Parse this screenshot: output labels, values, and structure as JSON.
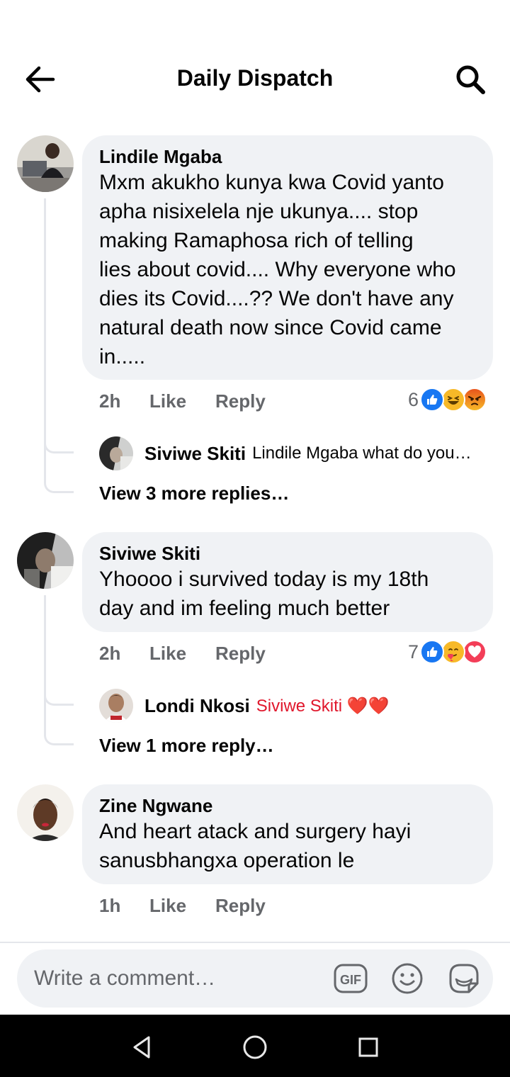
{
  "header": {
    "title": "Daily Dispatch",
    "back_icon": "arrow-left-icon",
    "search_icon": "search-icon"
  },
  "colors": {
    "bubble": "#f0f2f5",
    "meta_text": "#65676b",
    "like_blue": "#1877f2",
    "love_red": "#f33e58",
    "haha_yellow": "#f7b928"
  },
  "comments": [
    {
      "author": "Lindile Mgaba",
      "lines": [
        "Mxm akukho kunya kwa Covid yanto",
        "apha nisixelela nje ukunya.... stop",
        "making Ramaphosa rich of telling",
        "lies about covid.... Why everyone who",
        "dies its Covid....?? We don't have any",
        "natural death now since Covid came",
        "in....."
      ],
      "time": "2h",
      "like": "Like",
      "reply": "Reply",
      "reaction_count": "6",
      "reactions": [
        "like-icon",
        "haha-icon",
        "angry-icon"
      ],
      "replies": [
        {
          "author": "Siviwe Skiti",
          "text": "Lindile Mgaba what do you…"
        }
      ],
      "view_more": "View 3 more replies…"
    },
    {
      "author": "Siviwe Skiti",
      "lines": [
        "Yhoooo i survived today is my 18th",
        "day and im feeling much better"
      ],
      "time": "2h",
      "like": "Like",
      "reply": "Reply",
      "reaction_count": "7",
      "reactions": [
        "like-icon",
        "care-icon",
        "love-icon"
      ],
      "replies": [
        {
          "author": "Londi Nkosi",
          "text": "Siviwe Skiti ❤️❤️"
        }
      ],
      "view_more": "View 1 more reply…"
    },
    {
      "author": "Zine Ngwane",
      "lines": [
        "And heart atack and surgery hayi",
        "sanusbhangxa operation le"
      ],
      "time": "1h",
      "like": "Like",
      "reply": "Reply"
    }
  ],
  "composer": {
    "placeholder": "Write a comment…",
    "gif_label": "GIF",
    "icons": [
      "gif-icon",
      "emoji-icon",
      "sticker-icon"
    ]
  },
  "navbar": {
    "icons": [
      "nav-back-icon",
      "nav-home-icon",
      "nav-recents-icon"
    ]
  }
}
